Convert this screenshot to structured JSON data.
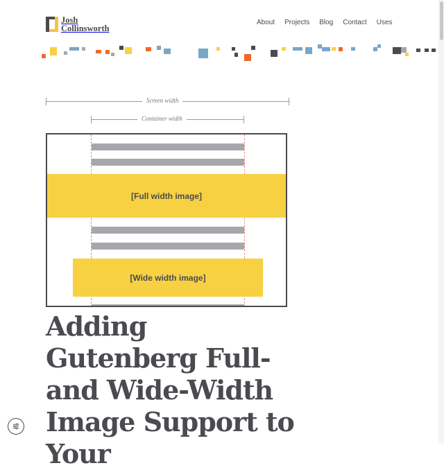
{
  "logo": {
    "line1": "Josh",
    "line2": "Collinsworth"
  },
  "nav": {
    "items": [
      "About",
      "Projects",
      "Blog",
      "Contact",
      "Uses"
    ]
  },
  "diagram": {
    "screen_width_label": "Screen width",
    "container_width_label": "Container width",
    "full_width_label": "[Full width image]",
    "wide_width_label": "[Wide width image]"
  },
  "article": {
    "title": "Adding Gutenberg Full- and Wide-Width Image Support to Your"
  },
  "colors": {
    "accent_yellow": "#f7d142",
    "text": "#4a4a4f",
    "orange": "#f0682a",
    "blue": "#7aa6c7",
    "gray": "#a7a7ab"
  },
  "icons": {
    "settings": "sliders-icon"
  }
}
